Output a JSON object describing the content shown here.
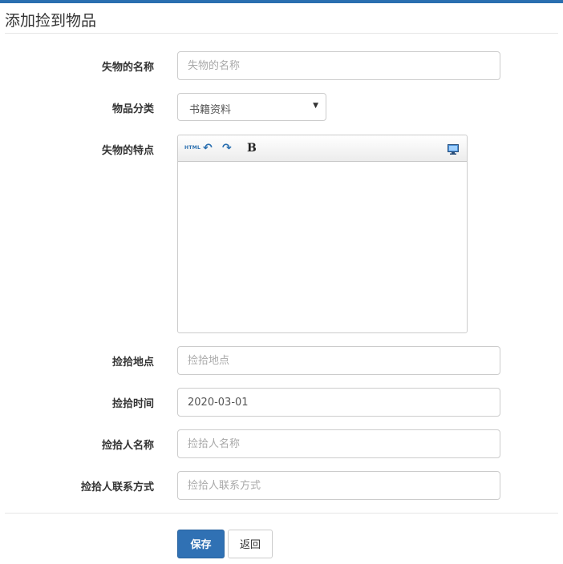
{
  "page": {
    "title": "添加捡到物品"
  },
  "form": {
    "item_name": {
      "label": "失物的名称",
      "placeholder": "失物的名称",
      "value": ""
    },
    "category": {
      "label": "物品分类",
      "selected": "书籍资料"
    },
    "features": {
      "label": "失物的特点",
      "toolbar": {
        "html_label": "HTML",
        "bold_label": "B",
        "icons": [
          "html-icon",
          "undo-icon",
          "redo-icon",
          "bold-icon",
          "fullscreen-icon"
        ]
      }
    },
    "found_location": {
      "label": "捡拾地点",
      "placeholder": "捡拾地点",
      "value": ""
    },
    "found_time": {
      "label": "捡拾时间",
      "value": "2020-03-01"
    },
    "finder_name": {
      "label": "捡拾人名称",
      "placeholder": "捡拾人名称",
      "value": ""
    },
    "finder_contact": {
      "label": "捡拾人联系方式",
      "placeholder": "捡拾人联系方式",
      "value": ""
    }
  },
  "actions": {
    "save_label": "保存",
    "back_label": "返回"
  },
  "colors": {
    "accent": "#2a6fb0",
    "primary_button": "#3071b4",
    "border": "#cccccc"
  }
}
